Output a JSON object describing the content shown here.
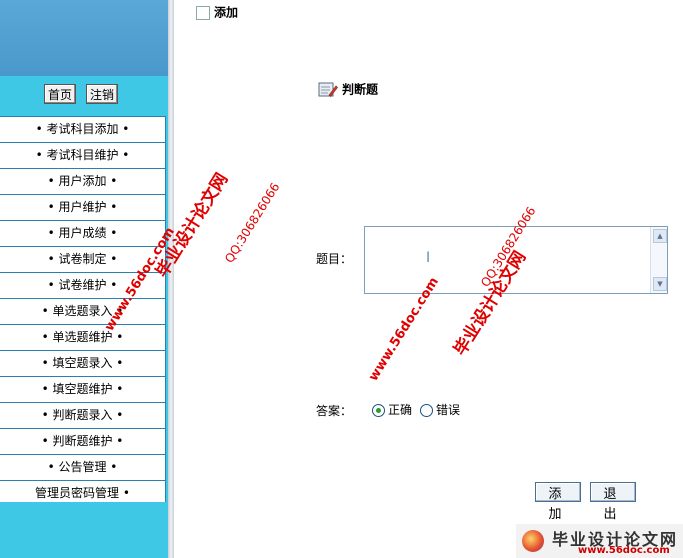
{
  "left_frame": {
    "home_btn": "首页",
    "logout_btn": "注销",
    "menu": [
      "• 考试科目添加 •",
      "• 考试科目维护 •",
      "• 用户添加 •",
      "• 用户维护 •",
      "• 用户成绩 •",
      "• 试卷制定 •",
      "• 试卷维护 •",
      "• 单选题录入 •",
      "• 单选题维护 •",
      "• 填空题录入 •",
      "• 填空题维护 •",
      "• 判断题录入 •",
      "• 判断题维护 •",
      "• 公告管理 •",
      "管理员密码管理 •"
    ]
  },
  "content": {
    "top_add_label": "添加",
    "section_title": "判断题",
    "question_label": "题目：",
    "question_value": "",
    "answer_label": "答案：",
    "answer_options": [
      "正确",
      "错误"
    ],
    "answer_selected": "正确",
    "add_button": "添加",
    "exit_button": "退出"
  },
  "watermark": {
    "site_name": "毕业设计论文网",
    "url": "www.56doc.com",
    "qq": "QQ:306826066",
    "footer_url": "www.56doc.com",
    "color": "#e00000"
  },
  "colors": {
    "left_bg": "#3fc8e6",
    "menu_border": "#2a7fae",
    "radio_on": "#21a121"
  }
}
